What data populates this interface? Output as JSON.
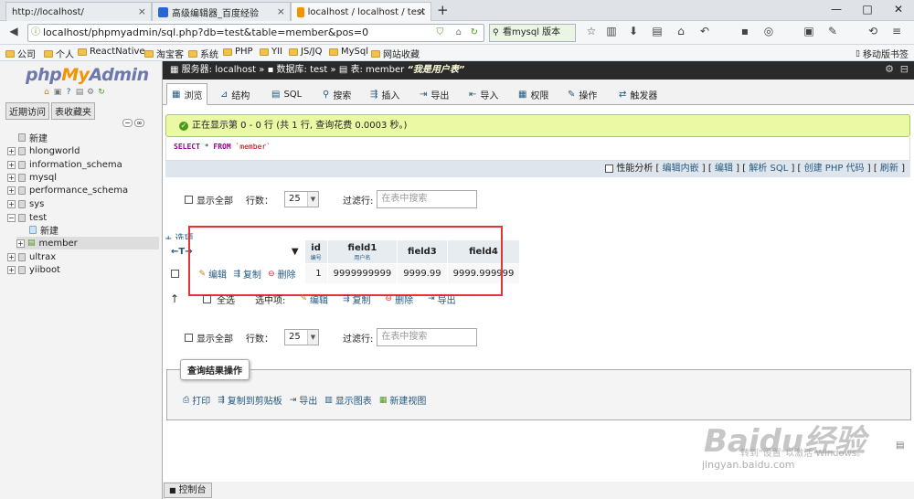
{
  "browser": {
    "tabs": [
      {
        "title": "http://localhost/"
      },
      {
        "title": "高级编辑器_百度经验"
      },
      {
        "title": "localhost / localhost / test"
      }
    ],
    "new_tab": "+",
    "window": {
      "minimize": "—",
      "maximize": "□",
      "close": "✕"
    },
    "url": "localhost/phpmyadmin/sql.php?db=test&table=member&pos=0",
    "search": "看mysql 版本",
    "bookmarks": [
      {
        "label": "公司"
      },
      {
        "label": "个人"
      },
      {
        "label": "ReactNative"
      },
      {
        "label": "淘宝客"
      },
      {
        "label": "系统"
      },
      {
        "label": "PHP"
      },
      {
        "label": "YII"
      },
      {
        "label": "JS/JQ"
      },
      {
        "label": "MySql"
      },
      {
        "label": "网站收藏"
      }
    ],
    "mobile_bookmarks": "移动版书签"
  },
  "sidebar": {
    "logo_php": "php",
    "logo_my": "My",
    "logo_admin": "Admin",
    "tabs": [
      "近期访问",
      "表收藏夹"
    ],
    "tree": [
      {
        "label": "新建"
      },
      {
        "label": "hlongworld"
      },
      {
        "label": "information_schema"
      },
      {
        "label": "mysql"
      },
      {
        "label": "performance_schema"
      },
      {
        "label": "sys"
      },
      {
        "label": "test"
      },
      {
        "label": "新建"
      },
      {
        "label": "member"
      },
      {
        "label": "ultrax"
      },
      {
        "label": "yiiboot"
      }
    ]
  },
  "breadcrumb": {
    "server_label": "服务器:",
    "server": "localhost",
    "db_label": "数据库:",
    "db": "test",
    "table_label": "表:",
    "table": "member",
    "comment": "“我是用户表”"
  },
  "tabs": [
    "浏览",
    "结构",
    "SQL",
    "搜索",
    "插入",
    "导出",
    "导入",
    "权限",
    "操作",
    "触发器"
  ],
  "message": "正在显示第 0 - 0 行 (共 1 行, 查询花费 0.0003 秒。)",
  "sql": {
    "select": "SELECT",
    "star": "*",
    "from": "FROM",
    "table": "`member`"
  },
  "sql_links": {
    "profiling": "性能分析",
    "inline": "编辑内嵌",
    "edit": "编辑",
    "explain": "解析 SQL",
    "php": "创建 PHP 代码",
    "refresh": "刷新"
  },
  "nav": {
    "show_all": "显示全部",
    "rows_label": "行数：",
    "rows_value": "25",
    "filter_label": "过滤行:",
    "filter_placeholder": "在表中搜索"
  },
  "options_link": "+ 选项",
  "table": {
    "headers": [
      {
        "label": "id",
        "comment": "编号"
      },
      {
        "label": "field1",
        "comment": "用户名"
      },
      {
        "label": "field3",
        "comment": ""
      },
      {
        "label": "field4",
        "comment": ""
      }
    ],
    "rows": [
      {
        "edit": "编辑",
        "copy": "复制",
        "delete": "删除",
        "cells": [
          "1",
          "9999999999",
          "9999.99",
          "9999.999999"
        ]
      }
    ]
  },
  "bulk": {
    "select_all": "全选",
    "with_selected": "选中项:",
    "edit": "编辑",
    "copy": "复制",
    "delete": "删除",
    "export": "导出"
  },
  "query_ops": {
    "legend": "查询结果操作",
    "actions": [
      "打印",
      "复制到剪贴板",
      "导出",
      "显示图表",
      "新建视图"
    ]
  },
  "console": "控制台",
  "watermark": {
    "main": "Baidu经验",
    "sub": "jingyan.baidu.com",
    "activate": "转到\"设置\"以激活 Windows。"
  },
  "colors": {
    "accent": "#235a81",
    "success_bg": "#ebf8a4",
    "highlight": "#e3343b",
    "breadcrumb_bg": "#2a2a2a"
  }
}
